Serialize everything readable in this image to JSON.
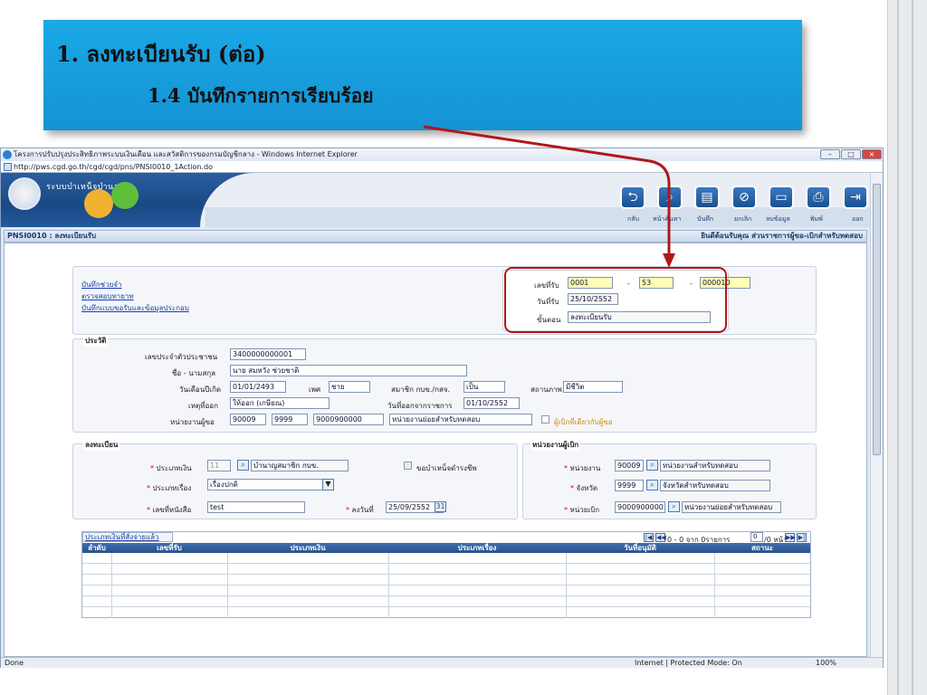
{
  "slide": {
    "title_line1": "1. ลงทะเบียนรับ (ต่อ)",
    "title_line2": "1.4 บันทึกรายการเรียบร้อย"
  },
  "browser": {
    "title": "โครงการปรับปรุงประสิทธิภาพระบบเงินเดือน และสวัสดิการของกรมบัญชีกลาง - Windows Internet Explorer",
    "url": "http://pws.cgd.go.th/cgd/cgd/pns/PNSI0010_1Action.do",
    "status_left": "Done",
    "status_zone": "Internet | Protected Mode: On",
    "zoom": "100%"
  },
  "app": {
    "system_name": "ระบบบำเหน็จบำนาญฯ",
    "toolbar": [
      {
        "label": "กลับ",
        "icon": "back-icon"
      },
      {
        "label": "หน้าค้นหา",
        "icon": "search-icon"
      },
      {
        "label": "บันทึก",
        "icon": "save-icon"
      },
      {
        "label": "ยกเลิก",
        "icon": "cancel-icon"
      },
      {
        "label": "ลบข้อมูล",
        "icon": "delete-icon"
      },
      {
        "label": "พิมพ์",
        "icon": "print-icon"
      },
      {
        "label": "ออก",
        "icon": "exit-icon"
      }
    ],
    "page_title": "PNSI0010 : ลงทะเบียนรับ",
    "welcome": "ยินดีต้อนรับคุณ ส่วนราชการผู้ขอ-เบิกสำหรับทดสอบ"
  },
  "links": [
    "บันทึกช่วยจำ",
    "ตรวจสอบทายาท",
    "บันทึกแบบขอรับและข้อมูลประกอบ"
  ],
  "register": {
    "lbl_no": "เลขที่รับ",
    "no1": "0001",
    "no2": "53",
    "no3": "000010",
    "lbl_date": "วันที่รับ",
    "date": "25/10/2552",
    "lbl_step": "ขั้นตอน",
    "step": "ลงทะเบียนรับ"
  },
  "history": {
    "section": "ประวัติ",
    "lbl_id": "เลขประจำตัวประชาชน",
    "id": "3400000000001",
    "lbl_name": "ชื่อ - นามสกุล",
    "name": "นาย สมหวัง ช่วยชาติ",
    "lbl_birth": "วันเดือนปีเกิด",
    "birth": "01/01/2493",
    "lbl_sex": "เพศ",
    "sex": "ชาย",
    "lbl_member": "สมาชิก กบข./กสจ.",
    "member": "เป็น",
    "lbl_status": "สถานภาพ",
    "status": "มีชีวิต",
    "lbl_reason": "เหตุที่ออก",
    "reason": "ให้ออก (เกษียณ)",
    "lbl_leave": "วันที่ออกจากราชการ",
    "leave": "01/10/2552",
    "lbl_unit": "หน่วยงานผู้ขอ",
    "unit1": "90009",
    "unit2": "9999",
    "unit3": "9000900000",
    "unit_name": "หน่วยงานย่อยสำหรับทดสอบ",
    "same_label": "ผู้เบิกที่เดียวกับผู้ขอ"
  },
  "reg": {
    "section": "ลงทะเบียน",
    "lbl_money": "ประเภทเงิน",
    "money_code": "11",
    "money_name": "บำนาญสมาชิก กบข.",
    "chk_label": "ขอบำเหน็จดำรงชีพ",
    "lbl_matter": "ประเภทเรื่อง",
    "matter": "เรื่องปกติ",
    "lbl_book": "เลขที่หนังสือ",
    "book": "test",
    "lbl_bookdate": "ลงวันที่",
    "bookdate": "25/09/2552"
  },
  "payer": {
    "section": "หน่วยงานผู้เบิก",
    "lbl_unit": "หน่วยงาน",
    "unit": "90009",
    "unit_name": "หน่วยงานสำหรับทดสอบ",
    "lbl_prov": "จังหวัด",
    "prov": "9999",
    "prov_name": "จังหวัดสำหรับทดสอบ",
    "lbl_payunit": "หน่วยเบิก",
    "payunit": "9000900000",
    "payunit_name": "หน่วยงานย่อยสำหรับทดสอบ"
  },
  "grid": {
    "title": "ประเภทเงินที่สั่งจ่ายแล้ว",
    "pager": "0 - 0 จาก 0รายการ",
    "page_input": "0",
    "page_total": "/0 หน้า",
    "headers": [
      "ลำดับ",
      "เลขที่รับ",
      "ประเภทเงิน",
      "ประเภทเรื่อง",
      "วันที่อนุมัติ",
      "สถานะ"
    ]
  }
}
